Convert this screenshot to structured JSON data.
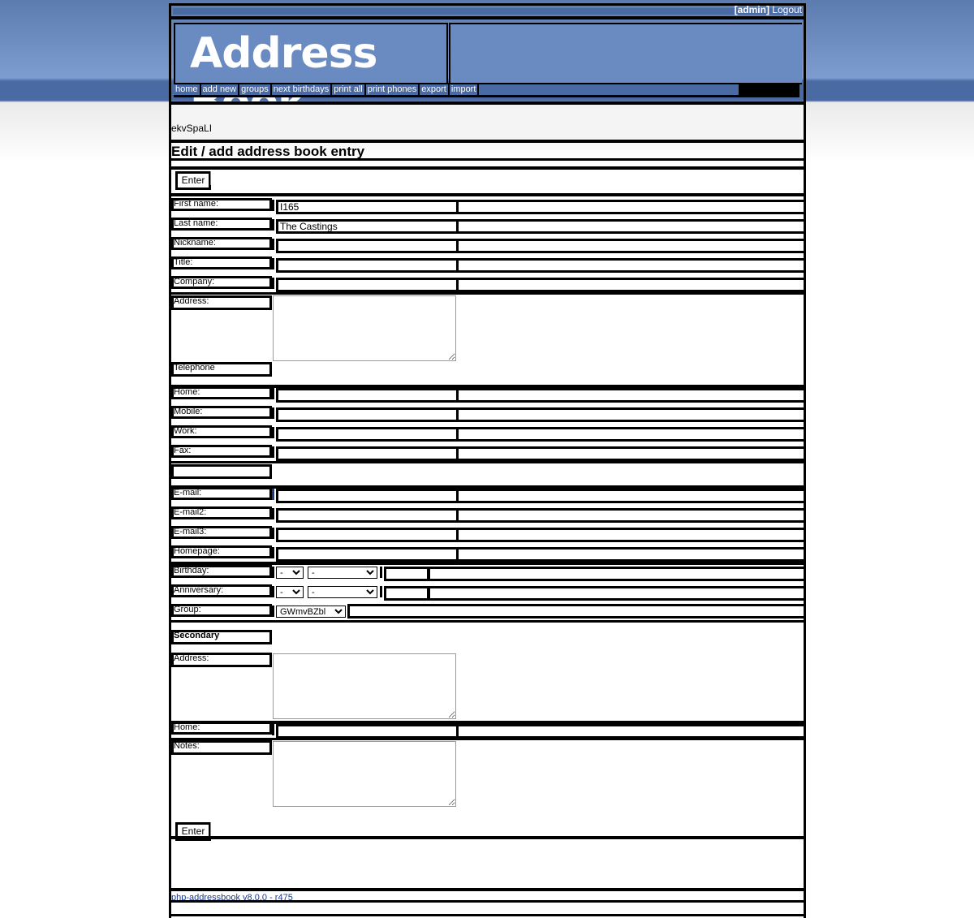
{
  "header": {
    "user": "[admin]",
    "logout": "Logout",
    "logo": "Address Book"
  },
  "nav": [
    "home",
    "add new",
    "groups",
    "next birthdays",
    "print all",
    "print phones",
    "export",
    "import"
  ],
  "token": "ekvSpaLI",
  "page_title": "Edit / add address book entry",
  "buttons": {
    "enter": "Enter"
  },
  "fields": {
    "firstname": {
      "label": "First name:",
      "value": "I165"
    },
    "lastname": {
      "label": "Last name:",
      "value": "The Castings"
    },
    "nickname": {
      "label": "Nickname:",
      "value": ""
    },
    "title": {
      "label": "Title:",
      "value": ""
    },
    "company": {
      "label": "Company:",
      "value": ""
    },
    "address": {
      "label": "Address:",
      "value": ""
    },
    "telephone": {
      "label": "Telephone"
    },
    "home": {
      "label": "Home:",
      "value": ""
    },
    "mobile": {
      "label": "Mobile:",
      "value": ""
    },
    "work": {
      "label": "Work:",
      "value": ""
    },
    "fax": {
      "label": "Fax:",
      "value": ""
    },
    "email": {
      "label": "E-mail:",
      "value": ""
    },
    "email2": {
      "label": "E-mail2:",
      "value": ""
    },
    "email3": {
      "label": "E-mail3:",
      "value": ""
    },
    "homepage": {
      "label": "Homepage:",
      "value": ""
    },
    "birthday": {
      "label": "Birthday:",
      "day": "-",
      "month": "-",
      "year": ""
    },
    "anniversary": {
      "label": "Anniversary:",
      "day": "-",
      "month": "-",
      "year": ""
    },
    "group": {
      "label": "Group:",
      "value": "GWmvBZbl"
    },
    "secondary": {
      "label": "Secondary"
    },
    "address2": {
      "label": "Address:",
      "value": ""
    },
    "phone2": {
      "label": "Home:",
      "value": ""
    },
    "notes": {
      "label": "Notes:",
      "value": ""
    }
  },
  "footer": "php-addressbook v8.0.0 - r475"
}
